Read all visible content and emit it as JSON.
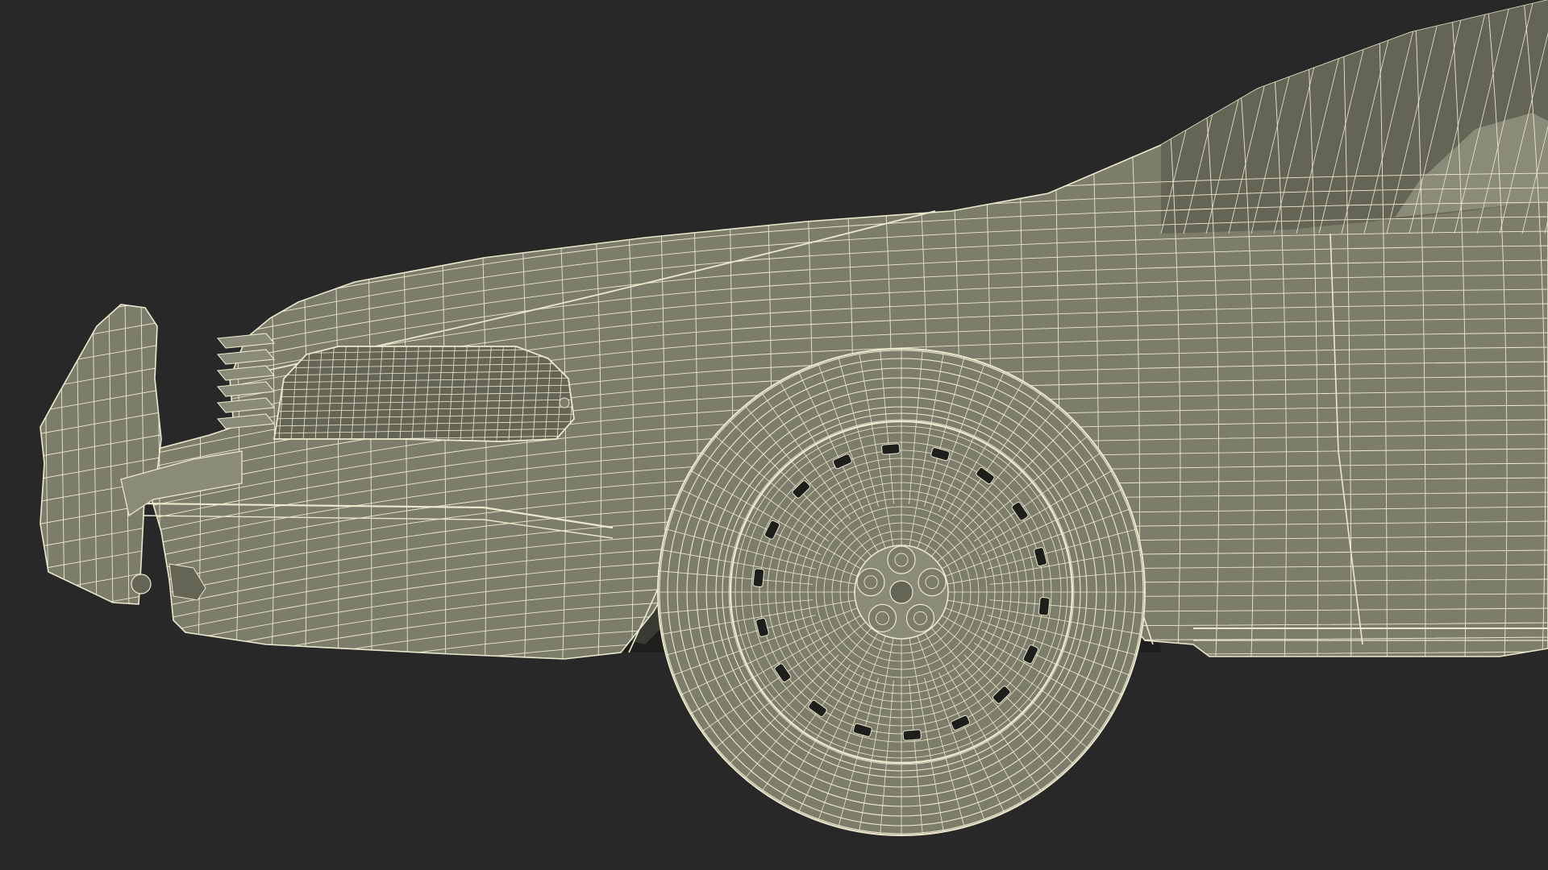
{
  "scene": {
    "subject": "car-front-wireframe",
    "colors": {
      "background": "#282828",
      "surface": "#7c7d6b",
      "surface_dark": "#646555",
      "surface_light": "#8a8b78",
      "wire": "#ede9cf",
      "interior": "#1e1e1c",
      "interior_mid": "#3a3a34"
    }
  }
}
